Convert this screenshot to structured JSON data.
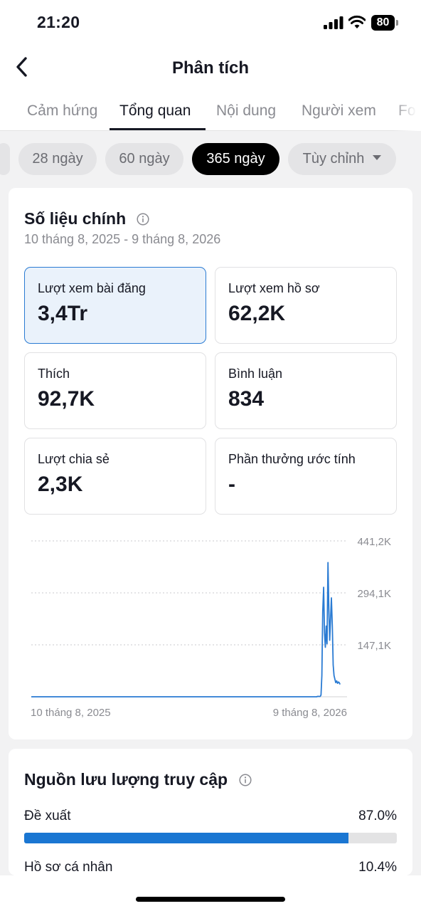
{
  "status_bar": {
    "time": "21:20",
    "battery": "80",
    "icons": [
      "signal-icon",
      "wifi-icon",
      "battery-icon"
    ]
  },
  "header": {
    "title": "Phân tích",
    "back_icon": "chevron-left-icon"
  },
  "tabs": [
    {
      "label": "Cảm hứng",
      "active": false
    },
    {
      "label": "Tổng quan",
      "active": true
    },
    {
      "label": "Nội dung",
      "active": false
    },
    {
      "label": "Người xem",
      "active": false
    },
    {
      "label": "Fo",
      "active": false
    }
  ],
  "date_filters": [
    {
      "label": "28 ngày",
      "active": false
    },
    {
      "label": "60 ngày",
      "active": false
    },
    {
      "label": "365 ngày",
      "active": true
    },
    {
      "label": "Tùy chỉnh",
      "active": false,
      "has_dropdown": true
    }
  ],
  "key_metrics": {
    "title": "Số liệu chính",
    "date_range": "10 tháng 8, 2025 - 9 tháng 8, 2026",
    "tiles": [
      {
        "label": "Lượt xem bài đăng",
        "value": "3,4Tr",
        "selected": true
      },
      {
        "label": "Lượt xem hồ sơ",
        "value": "62,2K",
        "selected": false
      },
      {
        "label": "Thích",
        "value": "92,7K",
        "selected": false
      },
      {
        "label": "Bình luận",
        "value": "834",
        "selected": false
      },
      {
        "label": "Lượt chia sẻ",
        "value": "2,3K",
        "selected": false
      },
      {
        "label": "Phần thưởng ước tính",
        "value": "-",
        "selected": false
      }
    ]
  },
  "chart_data": {
    "type": "line",
    "title": "",
    "xlabel": "",
    "ylabel": "",
    "x_tick_labels": [
      "10 tháng 8, 2025",
      "9 tháng 8, 2026"
    ],
    "y_tick_labels": [
      "441,2K",
      "294,1K",
      "147,1K"
    ],
    "y_ticks": [
      441200,
      294100,
      147100
    ],
    "ylim": [
      0,
      441200
    ],
    "x_day_range": [
      0,
      364
    ],
    "grid": true,
    "line_color": "#2a7bd3",
    "series": [
      {
        "x": [
          0,
          329,
          330,
          331,
          332,
          333,
          334,
          335,
          336,
          337,
          338,
          339,
          340,
          341,
          342,
          343,
          344,
          345,
          346,
          347,
          348,
          349,
          350,
          351,
          352,
          353,
          354,
          355,
          356
        ],
        "values": [
          0,
          0,
          1000,
          1200,
          900,
          1000,
          5000,
          60000,
          240000,
          310000,
          180000,
          140000,
          200000,
          150000,
          380000,
          250000,
          160000,
          220000,
          280000,
          200000,
          90000,
          60000,
          50000,
          40000,
          45000,
          38000,
          42000,
          40000,
          35000
        ]
      }
    ]
  },
  "traffic_sources": {
    "title": "Nguồn lưu lượng truy cập",
    "items": [
      {
        "label": "Đề xuất",
        "value": "87.0%",
        "fraction": 0.87
      },
      {
        "label": "Hồ sơ cá nhân",
        "value": "10.4%",
        "fraction": 0.104
      }
    ]
  },
  "colors": {
    "accent": "#1a76d2",
    "selected_tile_bg": "#eaf2fb",
    "active_chip_bg": "#000000"
  }
}
